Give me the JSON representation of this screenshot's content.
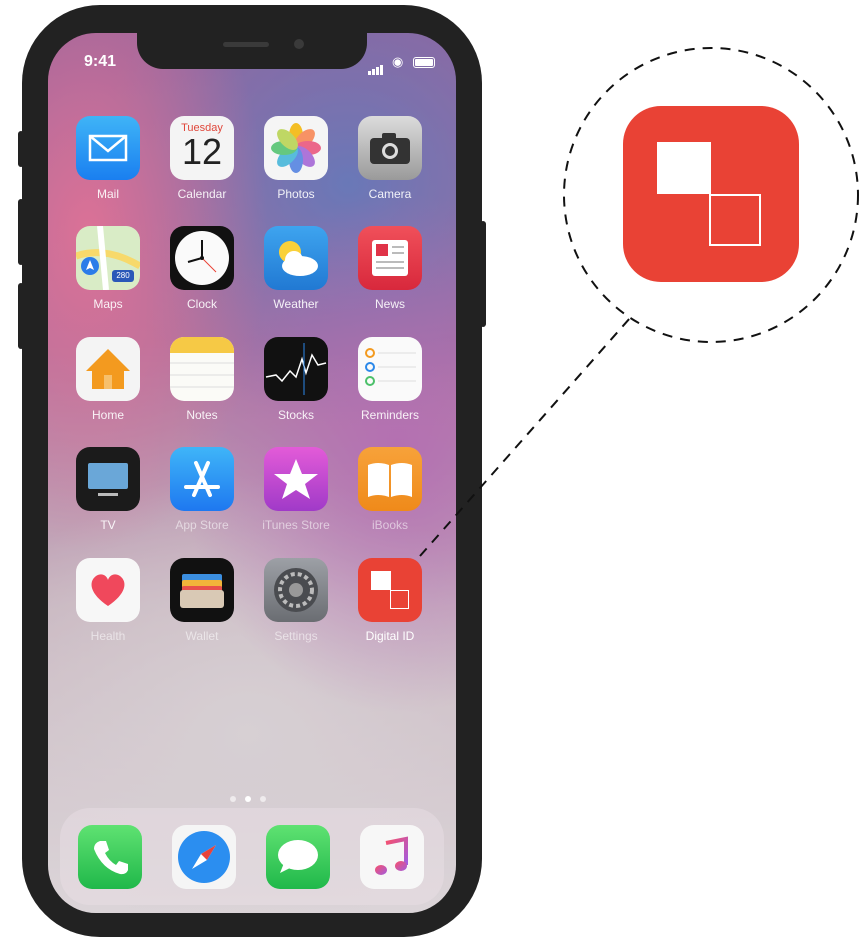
{
  "status_bar": {
    "time": "9:41"
  },
  "apps": [
    {
      "label": "Mail",
      "icon": "mail-icon"
    },
    {
      "label": "Calendar",
      "icon": "calendar-icon",
      "weekday": "Tuesday",
      "day": "12"
    },
    {
      "label": "Photos",
      "icon": "photos-icon"
    },
    {
      "label": "Camera",
      "icon": "camera-icon"
    },
    {
      "label": "Maps",
      "icon": "maps-icon",
      "badge": "280"
    },
    {
      "label": "Clock",
      "icon": "clock-icon"
    },
    {
      "label": "Weather",
      "icon": "weather-icon"
    },
    {
      "label": "News",
      "icon": "news-icon"
    },
    {
      "label": "Home",
      "icon": "home-icon"
    },
    {
      "label": "Notes",
      "icon": "notes-icon"
    },
    {
      "label": "Stocks",
      "icon": "stocks-icon"
    },
    {
      "label": "Reminders",
      "icon": "reminders-icon"
    },
    {
      "label": "TV",
      "icon": "tv-icon"
    },
    {
      "label": "App Store",
      "icon": "app-store-icon"
    },
    {
      "label": "iTunes Store",
      "icon": "itunes-store-icon"
    },
    {
      "label": "iBooks",
      "icon": "ibooks-icon"
    },
    {
      "label": "Health",
      "icon": "health-icon"
    },
    {
      "label": "Wallet",
      "icon": "wallet-icon"
    },
    {
      "label": "Settings",
      "icon": "settings-icon"
    },
    {
      "label": "Digital ID",
      "icon": "digital-id-icon"
    }
  ],
  "dock": [
    {
      "icon": "phone-icon"
    },
    {
      "icon": "safari-icon"
    },
    {
      "icon": "messages-icon"
    },
    {
      "icon": "music-icon"
    }
  ],
  "page_indicator": {
    "pages": 3,
    "current": 2
  },
  "colors": {
    "digital_id": "#e94235",
    "phone_frame": "#222222"
  }
}
